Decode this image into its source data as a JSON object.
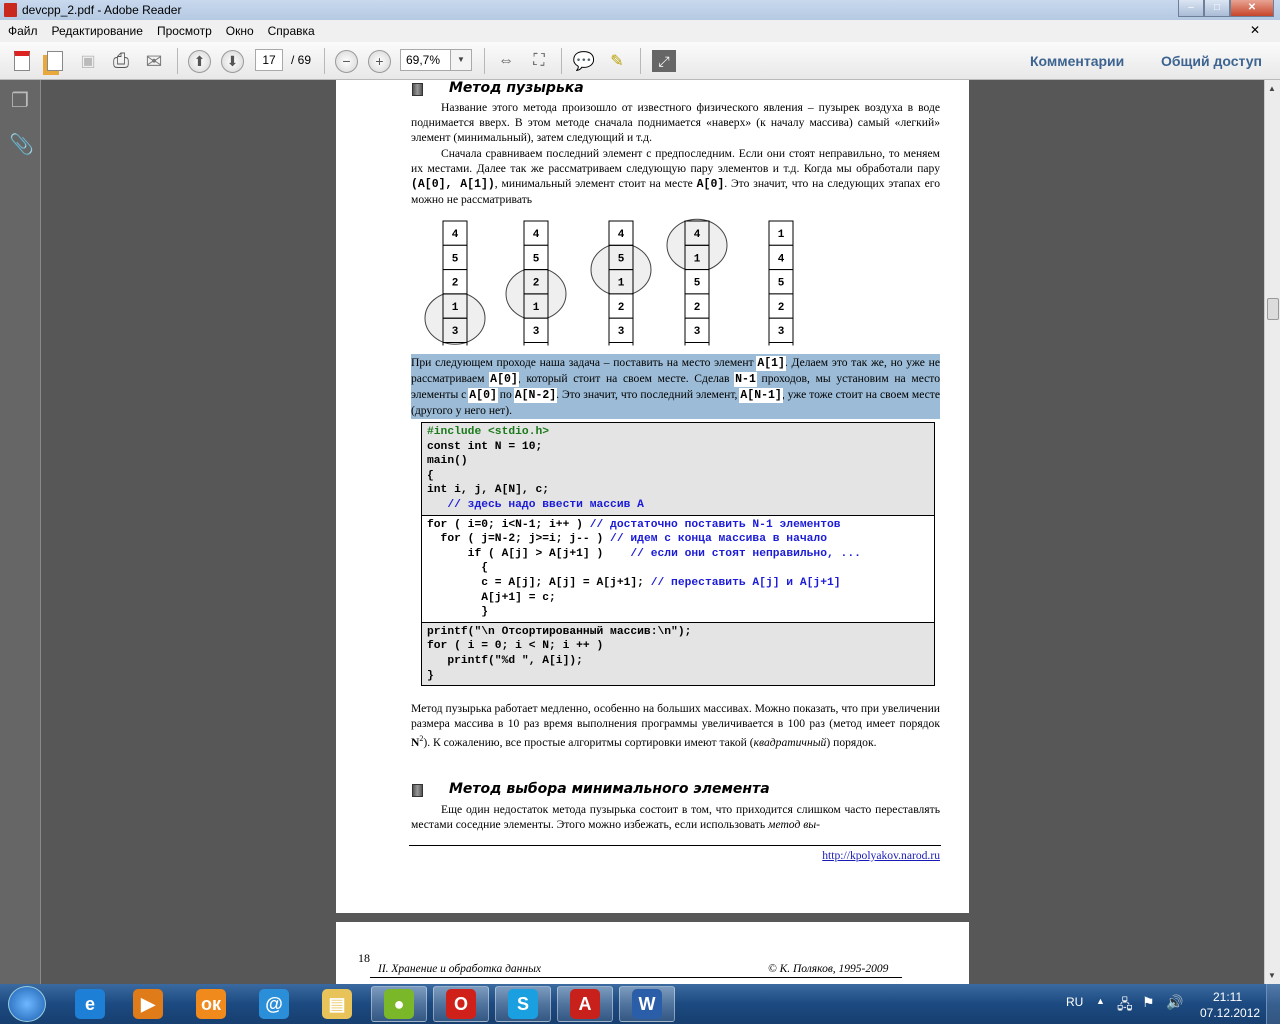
{
  "window": {
    "title": "devcpp_2.pdf - Adobe Reader",
    "minimize": "–",
    "maximize": "□",
    "close": "✕"
  },
  "menu": [
    "Файл",
    "Редактирование",
    "Просмотр",
    "Окно",
    "Справка"
  ],
  "menu_close": "✕",
  "toolbar": {
    "page_current": "17",
    "page_total": "/ 69",
    "zoom": "69,7%",
    "comments_label": "Комментарии",
    "share_label": "Общий доступ"
  },
  "document": {
    "heading1": "Метод пузырька",
    "para1": "Название этого метода произошло от известного физического явления – пузырек  воздуха в воде поднимается вверх. В этом методе сначала поднимается «наверх» (к началу массива) самый «легкий» элемент (минимальный), затем следующий и т.д.",
    "para2_a": "Сначала сравниваем последний элемент с предпоследним. Если они стоят неправильно, то меняем их местами. Далее так же рассматриваем следующую пару элементов и т.д. Когда мы обработали пару ",
    "para2_code1": "(A[0], A[1])",
    "para2_b": ", минимальный элемент стоит на месте ",
    "para2_code2": "A[0]",
    "para2_c": ". Это значит, что на следующих этапах его можно не рассматривать",
    "diagram": {
      "columns": [
        {
          "values": [
            "4",
            "5",
            "2",
            "1",
            "3"
          ],
          "highlight": [
            3,
            4
          ]
        },
        {
          "values": [
            "4",
            "5",
            "2",
            "1",
            "3"
          ],
          "highlight": [
            2,
            3
          ]
        },
        {
          "values": [
            "4",
            "5",
            "1",
            "2",
            "3"
          ],
          "highlight": [
            1,
            2
          ]
        },
        {
          "values": [
            "4",
            "1",
            "5",
            "2",
            "3"
          ],
          "highlight": [
            0,
            1
          ]
        },
        {
          "values": [
            "1",
            "4",
            "5",
            "2",
            "3"
          ],
          "highlight": []
        }
      ]
    },
    "para3": {
      "t1": "При следующем проходе наша задача – поставить на место элемент ",
      "c1": "A[1]",
      "t2": ". Делаем это так же, но уже не рассматриваем ",
      "c2": "A[0]",
      "t3": ", который стоит на своем месте. Сделав ",
      "c3": "N-1",
      "t4": " проходов, мы установим на место элементы с ",
      "c4": "A[0]",
      "t5": " по ",
      "c5": "A[N-2]",
      "t6": ". Это значит, что последний элемент, ",
      "c6": "A[N-1]",
      "t7": ", уже тоже стоит на своем месте (другого у него нет)."
    },
    "code": {
      "section1": [
        {
          "code": "#include <stdio.h>",
          "comment": ""
        },
        {
          "code": "const int N = 10;",
          "comment": ""
        },
        {
          "code": "main()",
          "comment": ""
        },
        {
          "code": "{",
          "comment": ""
        },
        {
          "code": "int i, j, A[N], c;",
          "comment": ""
        },
        {
          "code": "   ",
          "comment": "// здесь надо ввести массив A"
        }
      ],
      "section2": [
        {
          "code": "for ( i=0; i<N-1; i++ ) ",
          "comment": "// достаточно поставить N-1 элементов"
        },
        {
          "code": "  for ( j=N-2; j>=i; j-- ) ",
          "comment": "// идем с конца массива в начало"
        },
        {
          "code": "      if ( A[j] > A[j+1] )    ",
          "comment": "// если они стоят неправильно, ..."
        },
        {
          "code": "        {",
          "comment": ""
        },
        {
          "code": "        c = A[j]; A[j] = A[j+1]; ",
          "comment": "// переставить A[j] и A[j+1]"
        },
        {
          "code": "        A[j+1] = c;",
          "comment": ""
        },
        {
          "code": "        }",
          "comment": ""
        }
      ],
      "section3": [
        {
          "code": "printf(\"\\n Отсортированный массив:\\n\");",
          "comment": ""
        },
        {
          "code": "for ( i = 0; i < N; i ++ )",
          "comment": ""
        },
        {
          "code": "   printf(\"%d \", A[i]);",
          "comment": ""
        },
        {
          "code": "}",
          "comment": ""
        }
      ]
    },
    "para4_a": "Метод пузырька работает медленно, особенно на больших массивах. Можно показать, что при увеличении размера массива в 10 раз время выполнения программы увеличивается в 100 раз (метод имеет порядок ",
    "para4_n": "N",
    "para4_sup": "2",
    "para4_b": "). К сожалению, все простые алгоритмы сортировки имеют такой (",
    "para4_it": "квадратичный",
    "para4_c": ") порядок.",
    "heading2": "Метод выбора минимального элемента",
    "para5_a": "Еще один недостаток метода пузырька состоит в том, что приходится слишком часто переставлять местами соседние элементы. Этого можно избежать, если использовать ",
    "para5_it": "метод вы-",
    "footer_link": "http://kpolyakov.narod.ru",
    "page2_number": "18",
    "page2_left": "II. Хранение и обработка данных",
    "page2_right": "© К. Поляков, 1995-2009"
  },
  "taskbar": {
    "apps": [
      {
        "name": "internet-explorer",
        "glyph": "e",
        "color": "#1e7fd6"
      },
      {
        "name": "media-player",
        "glyph": "▶",
        "color": "#e07b1a"
      },
      {
        "name": "odnoklassniki",
        "glyph": "ок",
        "color": "#f08a1c"
      },
      {
        "name": "mail",
        "glyph": "@",
        "color": "#2a8fd8"
      },
      {
        "name": "explorer",
        "glyph": "▤",
        "color": "#e8c35a"
      },
      {
        "name": "chromium",
        "glyph": "●",
        "color": "#7ab829"
      },
      {
        "name": "opera",
        "glyph": "O",
        "color": "#d0201a"
      },
      {
        "name": "skype",
        "glyph": "S",
        "color": "#1aa0e0"
      },
      {
        "name": "adobe-reader",
        "glyph": "A",
        "color": "#c8201a"
      },
      {
        "name": "word",
        "glyph": "W",
        "color": "#2b5ea8"
      }
    ],
    "lang": "RU",
    "time": "21:11",
    "date": "07.12.2012"
  }
}
